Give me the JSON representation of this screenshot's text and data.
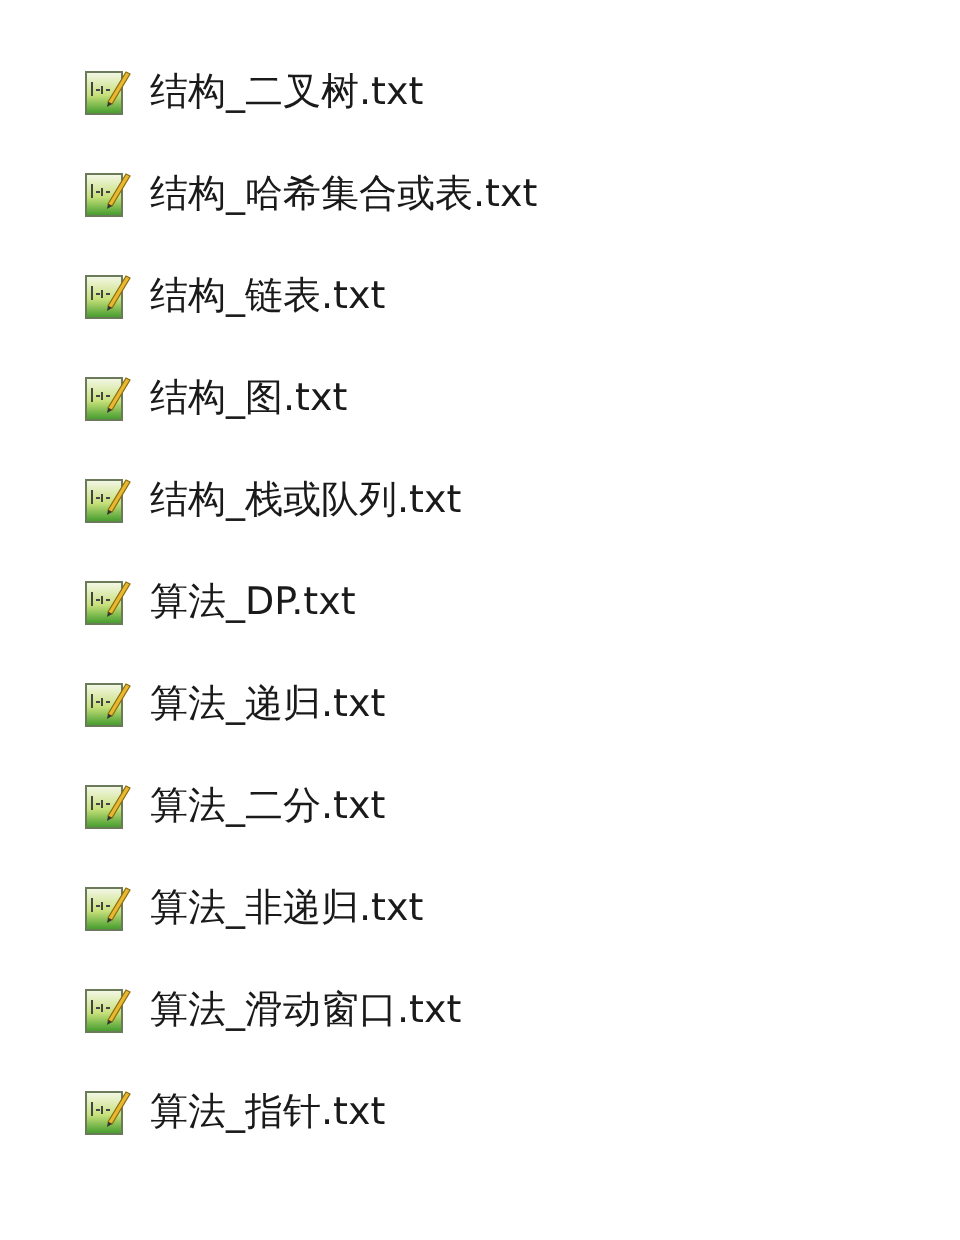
{
  "files": [
    {
      "name": "结构_二叉树.txt"
    },
    {
      "name": "结构_哈希集合或表.txt"
    },
    {
      "name": "结构_链表.txt"
    },
    {
      "name": "结构_图.txt"
    },
    {
      "name": "结构_栈或队列.txt"
    },
    {
      "name": "算法_DP.txt"
    },
    {
      "name": "算法_递归.txt"
    },
    {
      "name": "算法_二分.txt"
    },
    {
      "name": "算法_非递归.txt"
    },
    {
      "name": "算法_滑动窗口.txt"
    },
    {
      "name": "算法_指针.txt"
    }
  ]
}
